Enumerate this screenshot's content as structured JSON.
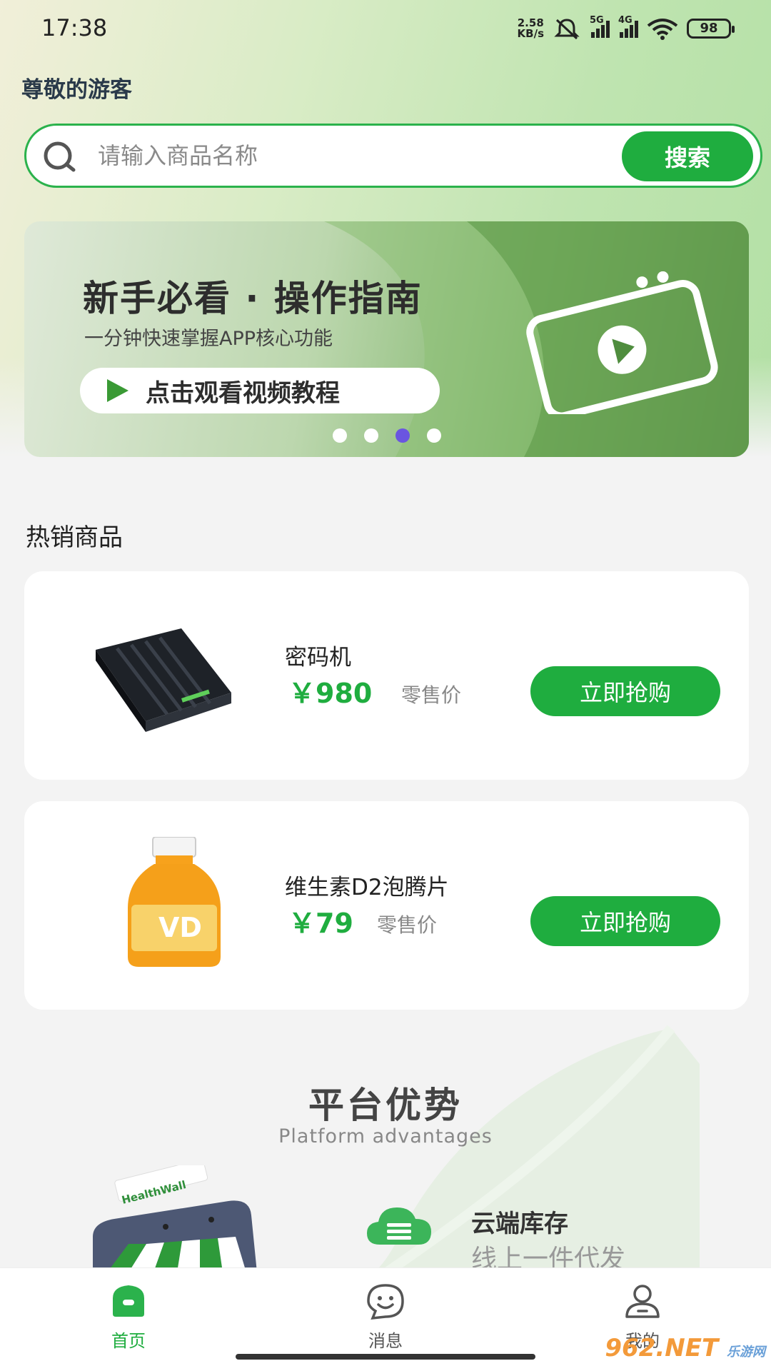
{
  "status_bar": {
    "time": "17:38",
    "net_speed_value": "2.58",
    "net_speed_unit": "KB/s",
    "signal_1": "5G",
    "signal_2": "4G",
    "battery": "98"
  },
  "header": {
    "greeting": "尊敬的游客"
  },
  "search": {
    "placeholder": "请输入商品名称",
    "button_label": "搜索"
  },
  "banner": {
    "title": "新手必看 · 操作指南",
    "subtitle": "一分钟快速掌握APP核心功能",
    "cta_label": "点击观看视频教程",
    "slide_count": 4,
    "active_slide": 3
  },
  "hot_products": {
    "section_title": "热销商品",
    "items": [
      {
        "name": "密码机",
        "price": "￥980",
        "price_label": "零售价",
        "button_label": "立即抢购"
      },
      {
        "name": "维生素D2泡腾片",
        "price": "￥79",
        "price_label": "零售价",
        "button_label": "立即抢购"
      }
    ]
  },
  "advantages": {
    "title": "平台优势",
    "subtitle": "Platform advantages",
    "store_sign": "HealthWall",
    "items": [
      {
        "title": "云端库存",
        "description": "线上一件代发",
        "icon": "cloud-icon"
      }
    ]
  },
  "tab_bar": {
    "tabs": [
      {
        "label": "首页",
        "icon": "home-icon",
        "active": true
      },
      {
        "label": "消息",
        "icon": "chat-icon",
        "active": false
      },
      {
        "label": "我的",
        "icon": "user-icon",
        "active": false
      }
    ]
  },
  "watermark": {
    "text": "962.NET",
    "sub": "乐游网"
  },
  "colors": {
    "accent": "#1fad3f",
    "active_dot": "#6a55e0"
  }
}
